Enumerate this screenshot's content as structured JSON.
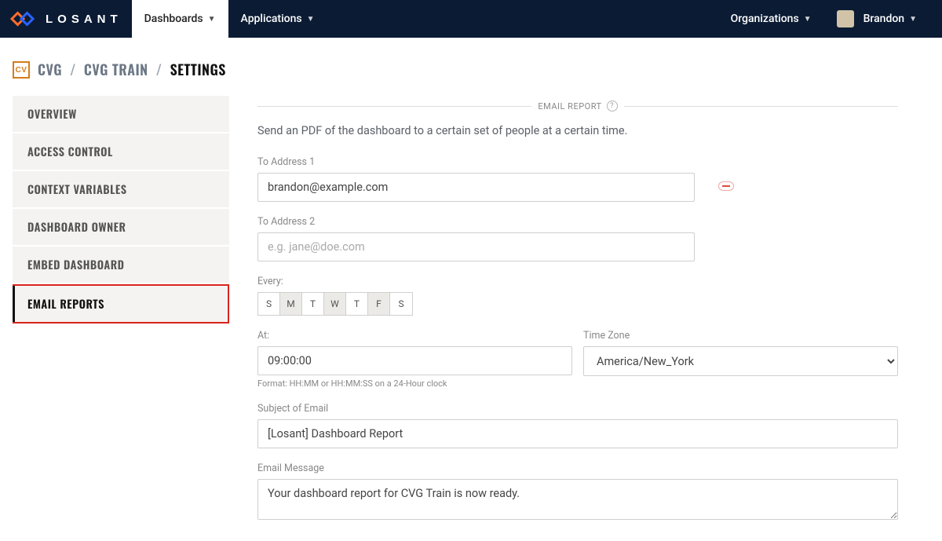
{
  "brand": {
    "name": "LOSANT"
  },
  "topnav": {
    "dashboards": "Dashboards",
    "applications": "Applications",
    "organizations": "Organizations",
    "user": "Brandon"
  },
  "breadcrumb": {
    "icon_text": "CV",
    "item1": "CVG",
    "item2": "CVG TRAIN",
    "current": "SETTINGS"
  },
  "sidebar": {
    "items": [
      {
        "label": "OVERVIEW"
      },
      {
        "label": "ACCESS CONTROL"
      },
      {
        "label": "CONTEXT VARIABLES"
      },
      {
        "label": "DASHBOARD OWNER"
      },
      {
        "label": "EMBED DASHBOARD"
      },
      {
        "label": "EMAIL REPORTS"
      }
    ]
  },
  "section": {
    "title": "EMAIL REPORT",
    "description": "Send an PDF of the dashboard to a certain set of people at a certain time."
  },
  "form": {
    "to1_label": "To Address 1",
    "to1_value": "brandon@example.com",
    "to2_label": "To Address 2",
    "to2_placeholder": "e.g. jane@doe.com",
    "every_label": "Every:",
    "days": [
      {
        "letter": "S",
        "on": false
      },
      {
        "letter": "M",
        "on": true
      },
      {
        "letter": "T",
        "on": false
      },
      {
        "letter": "W",
        "on": true
      },
      {
        "letter": "T",
        "on": false
      },
      {
        "letter": "F",
        "on": true
      },
      {
        "letter": "S",
        "on": false
      }
    ],
    "at_label": "At:",
    "at_value": "09:00:00",
    "at_hint": "Format: HH:MM or HH:MM:SS on a 24-Hour clock",
    "tz_label": "Time Zone",
    "tz_value": "America/New_York",
    "subject_label": "Subject of Email",
    "subject_value": "[Losant] Dashboard Report",
    "message_label": "Email Message",
    "message_value": "Your dashboard report for CVG Train is now ready."
  }
}
